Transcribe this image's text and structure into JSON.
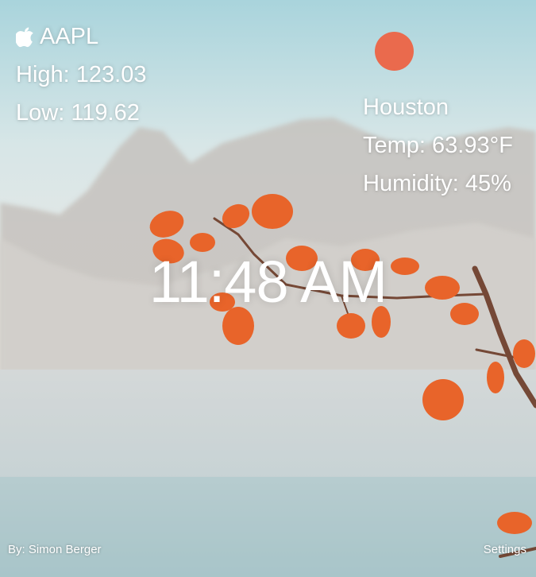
{
  "stock": {
    "icon": "apple-logo-icon",
    "ticker": "AAPL",
    "high": "High: 123.03",
    "low": "Low: 119.62"
  },
  "weather": {
    "icon": "sun-icon",
    "icon_color": "#ea6a4d",
    "city": "Houston",
    "temp": "Temp: 63.93°F",
    "humidity": "Humidity: 45%"
  },
  "clock": {
    "time": "11:48 AM"
  },
  "footer": {
    "credit": "By: Simon Berger",
    "settings_label": "Settings"
  }
}
